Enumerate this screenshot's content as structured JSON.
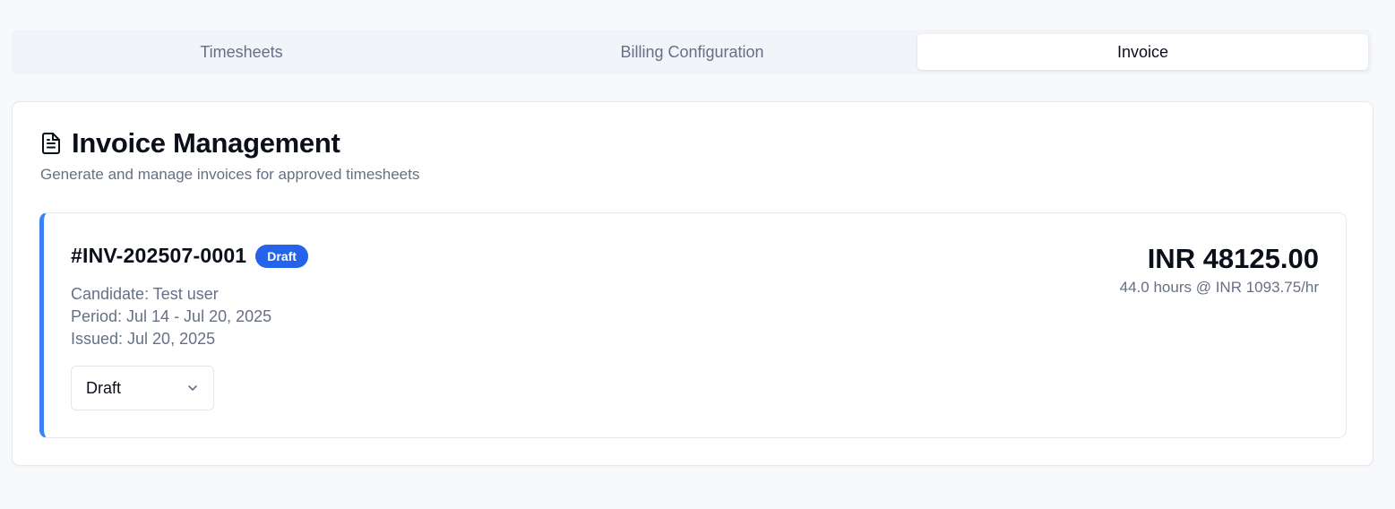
{
  "tabs": [
    {
      "label": "Timesheets",
      "active": false
    },
    {
      "label": "Billing Configuration",
      "active": false
    },
    {
      "label": "Invoice",
      "active": true
    }
  ],
  "page": {
    "icon": "document-icon",
    "title": "Invoice Management",
    "subtitle": "Generate and manage invoices for approved timesheets"
  },
  "invoice": {
    "number": "#INV-202507-0001",
    "badge": "Draft",
    "candidate": "Candidate: Test user",
    "period": "Period: Jul 14 - Jul 20, 2025",
    "issued": "Issued: Jul 20, 2025",
    "amount": "INR 48125.00",
    "rate": "44.0 hours @ INR 1093.75/hr",
    "status_value": "Draft",
    "accent_color": "#3b82f6",
    "badge_color": "#2563eb"
  }
}
